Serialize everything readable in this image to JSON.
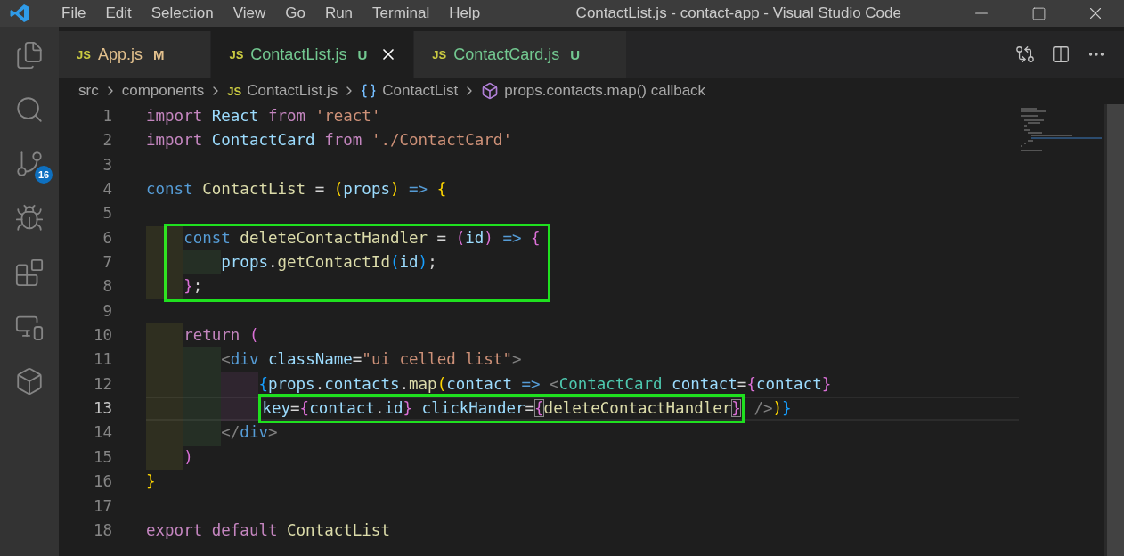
{
  "window": {
    "title": "ContactList.js - contact-app - Visual Studio Code"
  },
  "menu": [
    "File",
    "Edit",
    "Selection",
    "View",
    "Go",
    "Run",
    "Terminal",
    "Help"
  ],
  "activity_bar": [
    {
      "kind": "files",
      "selected": false
    },
    {
      "kind": "search",
      "selected": false
    },
    {
      "kind": "source-control",
      "selected": false,
      "badge": "16"
    },
    {
      "kind": "debug",
      "selected": false
    },
    {
      "kind": "extensions",
      "selected": false
    },
    {
      "kind": "remote",
      "selected": false
    },
    {
      "kind": "play-cube",
      "selected": false
    }
  ],
  "tabs": [
    {
      "icon": "JS",
      "label": "App.js",
      "status": "M",
      "color": "#e2c08d",
      "selected": false
    },
    {
      "icon": "JS",
      "label": "ContactList.js",
      "status": "U",
      "color": "#73c991",
      "selected": true
    },
    {
      "icon": "JS",
      "label": "ContactCard.js",
      "status": "U",
      "color": "#73c991",
      "selected": false
    }
  ],
  "breadcrumbs": [
    {
      "kind": "folder",
      "label": "src"
    },
    {
      "kind": "folder",
      "label": "components"
    },
    {
      "kind": "file",
      "icon": "JS",
      "label": "ContactList.js"
    },
    {
      "kind": "variable",
      "label": "ContactList"
    },
    {
      "kind": "method",
      "label": "props.contacts.map() callback"
    }
  ],
  "code": [
    {
      "number": "1",
      "current": false,
      "boxed": false,
      "tokens": [
        {
          "text": "import ",
          "kind": "control"
        },
        {
          "text": "React ",
          "kind": "variable"
        },
        {
          "text": "from ",
          "kind": "control"
        },
        {
          "text": "'react'",
          "kind": "string"
        }
      ]
    },
    {
      "number": "2",
      "current": false,
      "boxed": false,
      "tokens": [
        {
          "text": "import ",
          "kind": "control"
        },
        {
          "text": "ContactCard ",
          "kind": "variable"
        },
        {
          "text": "from ",
          "kind": "control"
        },
        {
          "text": "'./ContactCard'",
          "kind": "string"
        }
      ]
    },
    {
      "number": "3",
      "current": false,
      "boxed": false
    },
    {
      "number": "4",
      "current": false,
      "boxed": false,
      "tokens": [
        {
          "text": "const ",
          "kind": "storage"
        },
        {
          "text": "ContactList",
          "kind": "function"
        },
        {
          "text": " = ",
          "kind": "plain"
        },
        {
          "text": "(",
          "kind": "bracket1"
        },
        {
          "text": "props",
          "kind": "variable"
        },
        {
          "text": ")",
          "kind": "bracket1"
        },
        {
          "text": " => ",
          "kind": "storage"
        },
        {
          "text": "{",
          "kind": "bracket1"
        }
      ]
    },
    {
      "number": "5",
      "current": false,
      "boxed": false
    },
    {
      "number": "6",
      "current": false,
      "boxed": true,
      "tokens": [
        {
          "text": "    const ",
          "kind": "storage"
        },
        {
          "text": "deleteContactHandler",
          "kind": "function"
        },
        {
          "text": " = ",
          "kind": "plain"
        },
        {
          "text": "(",
          "kind": "bracket2"
        },
        {
          "text": "id",
          "kind": "variable"
        },
        {
          "text": ")",
          "kind": "bracket2"
        },
        {
          "text": " => ",
          "kind": "storage"
        },
        {
          "text": "{",
          "kind": "bracket2"
        }
      ]
    },
    {
      "number": "7",
      "current": false,
      "boxed": true,
      "tokens": [
        {
          "text": "        props",
          "kind": "variable"
        },
        {
          "text": ".",
          "kind": "plain"
        },
        {
          "text": "getContactId",
          "kind": "function"
        },
        {
          "text": "(",
          "kind": "bracket3"
        },
        {
          "text": "id",
          "kind": "variable"
        },
        {
          "text": ")",
          "kind": "bracket3"
        },
        {
          "text": ";",
          "kind": "plain"
        }
      ]
    },
    {
      "number": "8",
      "current": false,
      "boxed": true,
      "tokens": [
        {
          "text": "    }",
          "kind": "bracket2"
        },
        {
          "text": ";",
          "kind": "plain"
        }
      ]
    },
    {
      "number": "9",
      "current": false,
      "boxed": false
    },
    {
      "number": "10",
      "current": false,
      "boxed": false,
      "tokens": [
        {
          "text": "    return ",
          "kind": "control"
        },
        {
          "text": "(",
          "kind": "bracket2"
        }
      ]
    },
    {
      "number": "11",
      "current": false,
      "boxed": false,
      "tokens": [
        {
          "text": "        <",
          "kind": "tag-bracket"
        },
        {
          "text": "div ",
          "kind": "tag"
        },
        {
          "text": "className",
          "kind": "attribute"
        },
        {
          "text": "=",
          "kind": "plain"
        },
        {
          "text": "\"ui celled list\"",
          "kind": "string"
        },
        {
          "text": ">",
          "kind": "tag-bracket"
        }
      ]
    },
    {
      "number": "12",
      "current": false,
      "boxed": false,
      "tokens": [
        {
          "text": "            {",
          "kind": "bracket3"
        },
        {
          "text": "props",
          "kind": "variable"
        },
        {
          "text": ".",
          "kind": "plain"
        },
        {
          "text": "contacts",
          "kind": "variable"
        },
        {
          "text": ".",
          "kind": "plain"
        },
        {
          "text": "map",
          "kind": "function"
        },
        {
          "text": "(",
          "kind": "bracket1"
        },
        {
          "text": "contact ",
          "kind": "variable"
        },
        {
          "text": "=> ",
          "kind": "storage"
        },
        {
          "text": "<",
          "kind": "tag-bracket"
        },
        {
          "text": "ContactCard ",
          "kind": "component"
        },
        {
          "text": "contact",
          "kind": "attribute"
        },
        {
          "text": "=",
          "kind": "plain"
        },
        {
          "text": "{",
          "kind": "bracket2"
        },
        {
          "text": "contact",
          "kind": "variable"
        },
        {
          "text": "}",
          "kind": "bracket2"
        }
      ]
    },
    {
      "number": "13",
      "current": true,
      "boxed": false,
      "tokens": [
        {
          "kind": "highlight",
          "tokens": [
            {
              "text": "            key",
              "kind": "attribute"
            },
            {
              "text": "=",
              "kind": "plain"
            },
            {
              "text": "{",
              "kind": "bracket2"
            },
            {
              "text": "contact",
              "kind": "variable"
            },
            {
              "text": ".",
              "kind": "plain"
            },
            {
              "text": "id",
              "kind": "variable"
            },
            {
              "text": "}",
              "kind": "bracket2"
            },
            {
              "text": " clickHander",
              "kind": "attribute"
            },
            {
              "text": "=",
              "kind": "plain"
            },
            {
              "text": "{",
              "kind": "bracket2",
              "matched": true
            },
            {
              "text": "deleteContactHandler",
              "kind": "function"
            },
            {
              "text": "}",
              "kind": "bracket2",
              "matched": true
            }
          ]
        },
        {
          "text": " />",
          "kind": "tag-bracket"
        },
        {
          "text": ")",
          "kind": "bracket1"
        },
        {
          "text": "}",
          "kind": "bracket3"
        }
      ]
    },
    {
      "number": "14",
      "current": false,
      "boxed": false,
      "tokens": [
        {
          "text": "        </",
          "kind": "tag-bracket"
        },
        {
          "text": "div",
          "kind": "tag"
        },
        {
          "text": ">",
          "kind": "tag-bracket"
        }
      ]
    },
    {
      "number": "15",
      "current": false,
      "boxed": false,
      "tokens": [
        {
          "text": "    )",
          "kind": "bracket2"
        }
      ]
    },
    {
      "number": "16",
      "current": false,
      "boxed": false,
      "tokens": [
        {
          "text": "}",
          "kind": "bracket1"
        }
      ]
    },
    {
      "number": "17",
      "current": false,
      "boxed": false
    },
    {
      "number": "18",
      "current": false,
      "boxed": false,
      "tokens": [
        {
          "text": "export default ",
          "kind": "control"
        },
        {
          "text": "ContactList",
          "kind": "function"
        }
      ]
    }
  ]
}
